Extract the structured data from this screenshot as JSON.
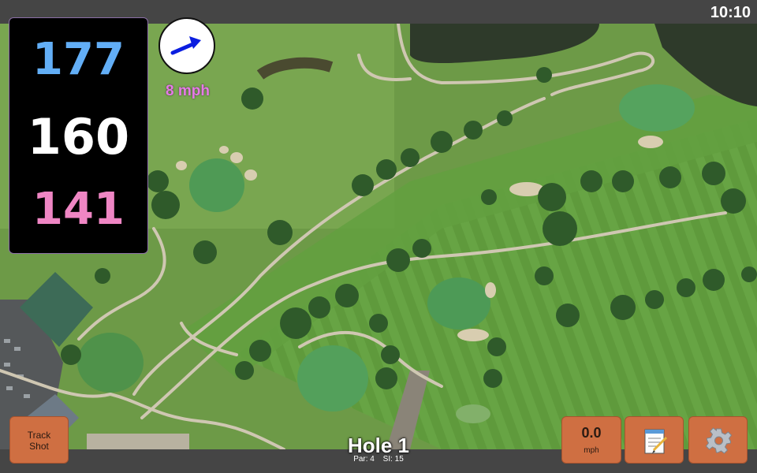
{
  "status": {
    "time": "10:10"
  },
  "distances": {
    "back": "177",
    "middle": "160",
    "front": "141"
  },
  "wind": {
    "speed_label": "8 mph",
    "arrow_color": "#0b1ee0"
  },
  "hole": {
    "title": "Hole 1",
    "par_label": "Par: 4",
    "si_label": "SI: 15"
  },
  "buttons": {
    "track_shot": "Track\nShot",
    "speed_value": "0.0",
    "speed_unit": "mph",
    "notes_icon": "notepad-icon",
    "settings_icon": "gear-icon"
  },
  "colors": {
    "button": "#cf6f42",
    "back_distance": "#62aef6",
    "middle_distance": "#ffffff",
    "front_distance": "#ef86c4",
    "wind_text": "#e67ae6"
  }
}
